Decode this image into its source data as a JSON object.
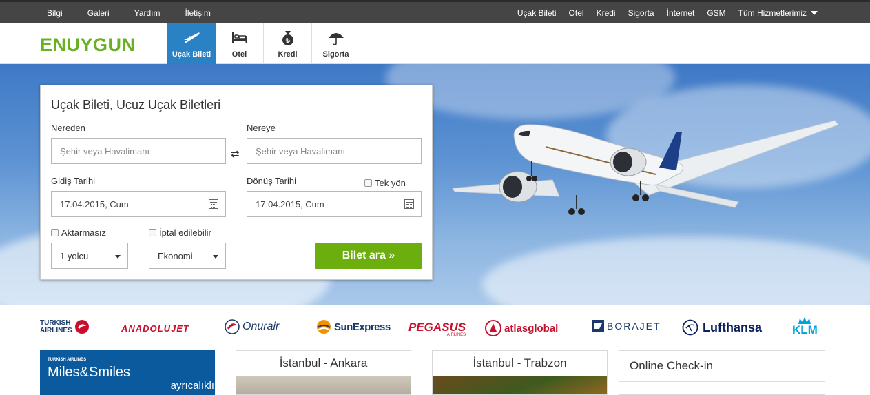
{
  "topbar": {
    "left_links": [
      "Bilgi",
      "Galeri",
      "Yardım",
      "İletişim"
    ],
    "right_links": [
      "Uçak Bileti",
      "Otel",
      "Kredi",
      "Sigorta",
      "İnternet",
      "GSM"
    ],
    "all_services": "Tüm Hizmetlerimiz"
  },
  "header": {
    "logo": "ENUYGUN",
    "tabs": [
      {
        "label": "Uçak Bileti",
        "icon": "plane-icon",
        "active": true
      },
      {
        "label": "Otel",
        "icon": "bed-icon",
        "active": false
      },
      {
        "label": "Kredi",
        "icon": "money-bag-icon",
        "active": false
      },
      {
        "label": "Sigorta",
        "icon": "umbrella-icon",
        "active": false
      }
    ]
  },
  "search": {
    "title": "Uçak Bileti, Ucuz Uçak Biletleri",
    "from_label": "Nereden",
    "from_placeholder": "Şehir veya Havalimanı",
    "to_label": "Nereye",
    "to_placeholder": "Şehir veya Havalimanı",
    "swap_icon": "⇄",
    "depart_label": "Gidiş Tarihi",
    "depart_value": "17.04.2015, Cum",
    "return_label": "Dönüş Tarihi",
    "return_value": "17.04.2015, Cum",
    "one_way_label": "Tek yön",
    "nonstop_label": "Aktarmasız",
    "refundable_label": "İptal edilebilir",
    "passengers_value": "1 yolcu",
    "cabin_value": "Ekonomi",
    "search_button": "Bilet ara »"
  },
  "airlines": [
    {
      "line1": "TURKISH",
      "line2": "AIRLINES"
    },
    {
      "line1": "ANADOLUJET"
    },
    {
      "line1": "Onurair"
    },
    {
      "line1": "SunExpress"
    },
    {
      "line1": "PEGASUS",
      "line2": "AIRLINES"
    },
    {
      "line1": "atlasglobal"
    },
    {
      "line1": "BORAJET"
    },
    {
      "line1": "Lufthansa"
    },
    {
      "line1": "KLM"
    }
  ],
  "tiles": {
    "miles_small": "TURKISH AIRLINES",
    "miles_title": "Miles&Smiles",
    "miles_sub": "ayrıcalıklı",
    "route1": "İstanbul - Ankara",
    "route2": "İstanbul - Trabzon",
    "checkin": "Online Check-in"
  },
  "colors": {
    "brand_green": "#6ab023",
    "active_tab": "#2a82c4",
    "button_green": "#6cae0e",
    "topbar": "#454545"
  }
}
